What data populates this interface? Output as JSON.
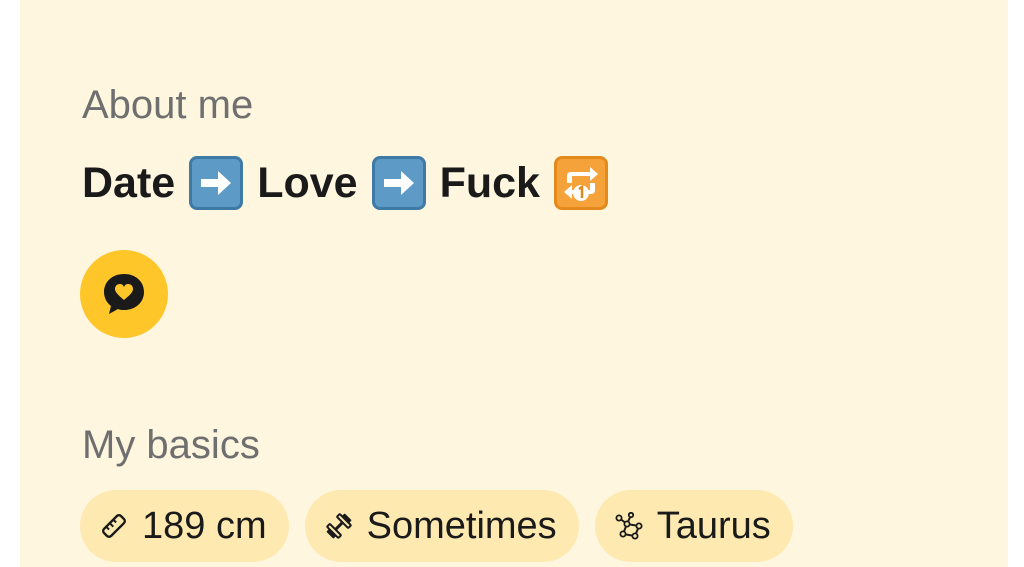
{
  "about": {
    "title": "About me",
    "bio_parts": [
      "Date",
      "Love",
      "Fuck"
    ],
    "bio_emojis": [
      "right-arrow-emoji",
      "right-arrow-emoji",
      "repeat-one-emoji"
    ]
  },
  "prompt_button": {
    "icon": "chat-heart-icon",
    "color": "#ffc629"
  },
  "basics": {
    "title": "My basics",
    "chips": [
      {
        "icon": "ruler-icon",
        "label": "189 cm"
      },
      {
        "icon": "dumbbell-icon",
        "label": "Sometimes"
      },
      {
        "icon": "constellation-icon",
        "label": "Taurus"
      }
    ]
  },
  "colors": {
    "panel_bg": "#fef6df",
    "chip_bg": "#fee9b1",
    "accent": "#ffc629",
    "muted_text": "#6f6f6f"
  }
}
